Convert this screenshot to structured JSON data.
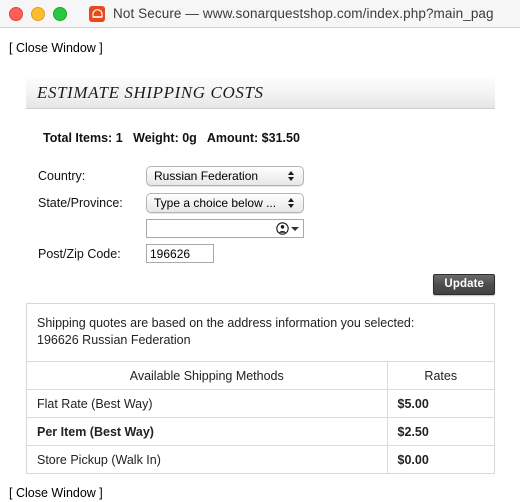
{
  "browser": {
    "security_label": "Not Secure",
    "separator": "—",
    "url": "www.sonarquestshop.com/index.php?main_pag",
    "site_icon": "orange-site-icon",
    "traffic_lights": [
      "close",
      "minimize",
      "maximize"
    ]
  },
  "page": {
    "close_window_top": "[ Close Window ]",
    "close_window_bottom": "[ Close Window ]",
    "heading": "ESTIMATE SHIPPING COSTS",
    "totals": {
      "items": "Total Items: 1",
      "weight": "Weight: 0g",
      "amount": "Amount: $31.50"
    },
    "form": {
      "country_label": "Country:",
      "country_value": "Russian Federation",
      "state_label": "State/Province:",
      "state_value": "Type a choice below ...",
      "state_freetext_value": "",
      "state_freetext_placeholder": "",
      "zip_label": "Post/Zip Code:",
      "zip_value": "196626"
    },
    "update_button": "Update",
    "quotes": {
      "note_line1": "Shipping quotes are based on the address information you selected:",
      "note_line2": "196626 Russian Federation",
      "table": {
        "headers": [
          "Available Shipping Methods",
          "Rates"
        ],
        "rows": [
          {
            "method": "Flat Rate (Best Way)",
            "rate": "$5.00",
            "selected": false
          },
          {
            "method": "Per Item (Best Way)",
            "rate": "$2.50",
            "selected": true
          },
          {
            "method": "Store Pickup (Walk In)",
            "rate": "$0.00",
            "selected": false
          }
        ]
      }
    }
  },
  "colors": {
    "traffic_close": "#ff5f57",
    "traffic_min": "#ffbd2e",
    "traffic_max": "#28c840",
    "site_icon": "#e8491f",
    "update_button": "#4e4e4e"
  }
}
